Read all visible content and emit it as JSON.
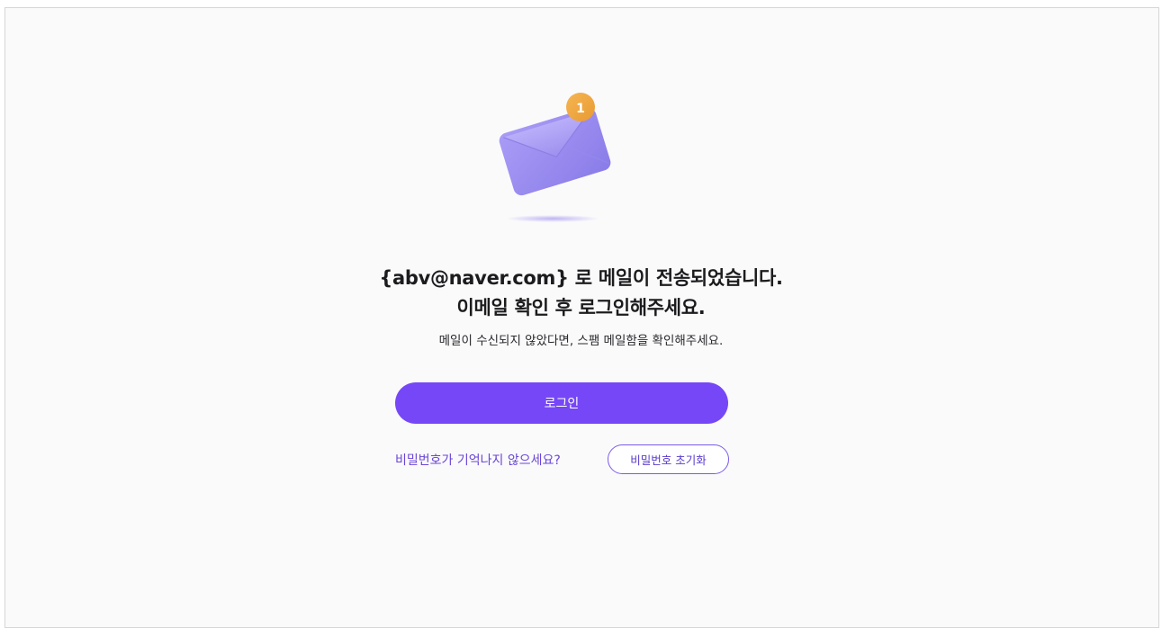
{
  "message": {
    "headline_line1": "{abv@naver.com} 로 메일이 전송되었습니다.",
    "headline_line2": "이메일 확인 후 로그인해주세요.",
    "subtext": "메일이 수신되지 않았다면, 스팸 메일함을 확인해주세요."
  },
  "illustration": {
    "icon": "envelope-icon",
    "badge_count": "1",
    "envelope_color": "#9b8ef0",
    "badge_color": "#f0a640"
  },
  "actions": {
    "login_label": "로그인",
    "forgot_password_text": "비밀번호가 기억나지 않으세요?",
    "reset_password_label": "비밀번호 초기화"
  },
  "colors": {
    "accent": "#7647f6",
    "link": "#6a45d6"
  }
}
